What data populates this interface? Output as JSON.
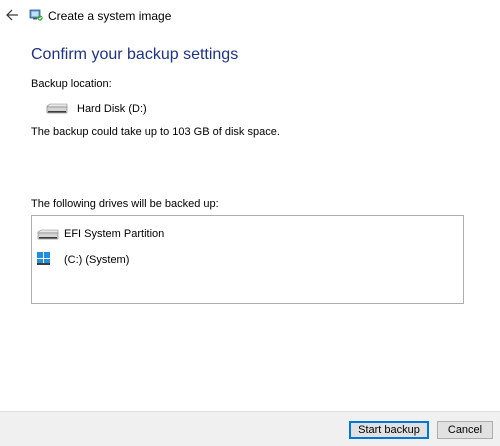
{
  "window": {
    "title": "Create a system image"
  },
  "header": {
    "heading": "Confirm your backup settings"
  },
  "backup_location": {
    "label": "Backup location:",
    "drive_name": "Hard Disk (D:)",
    "drive_icon": "hard-disk-icon"
  },
  "space_note": "The backup could take up to 103 GB of disk space.",
  "drives": {
    "label": "The following drives will be backed up:",
    "items": [
      {
        "label": "EFI System Partition",
        "icon": "hard-disk-icon"
      },
      {
        "label": "(C:) (System)",
        "icon": "windows-drive-icon"
      }
    ]
  },
  "footer": {
    "start_label": "Start backup",
    "cancel_label": "Cancel"
  },
  "colors": {
    "heading": "#1e3287",
    "accent": "#0078d7",
    "footer_bg": "#f0f0f0"
  }
}
